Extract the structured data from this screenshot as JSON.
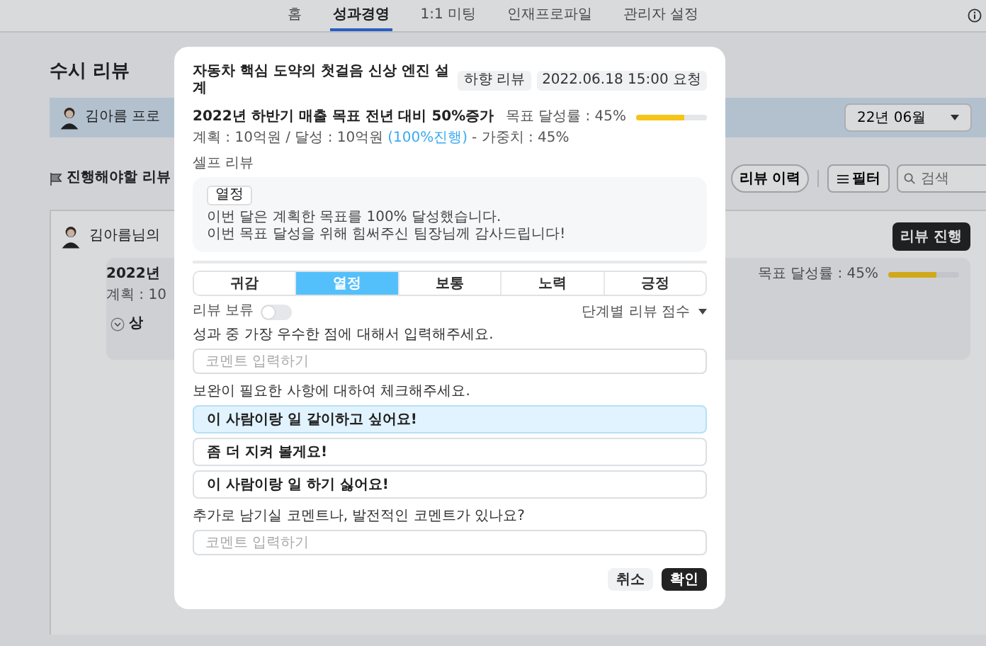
{
  "nav": {
    "items": [
      {
        "label": "홈",
        "selected": false
      },
      {
        "label": "성과경영",
        "selected": true
      },
      {
        "label": "1:1 미팅",
        "selected": false
      },
      {
        "label": "인재프로파일",
        "selected": false
      },
      {
        "label": "관리자 설정",
        "selected": false
      }
    ]
  },
  "page": {
    "title": "수시 리뷰",
    "profile_name": "김아름 프로",
    "month": "22년 06월",
    "section_title": "진행해야할 리뷰",
    "history_button": "리뷰 이력",
    "filter_button": "필터",
    "search_placeholder": "검색",
    "card": {
      "owner": "김아름님의",
      "action": "리뷰 진행",
      "goal": "2022년",
      "plan": "계획 : 10",
      "detail": "상",
      "progress_label": "목표 달성률 : 45%",
      "level": 0.68
    }
  },
  "dialog": {
    "title": "자동차 핵심 도약의 첫걸음 신상 엔진 설계",
    "tags": [
      "하향 리뷰",
      "2022.06.18 15:00 요청"
    ],
    "goal": {
      "title": "2022년 하반기 매출 목표 전년 대비 50%증가",
      "plan": "계획 : 10억원 / 달성 : 10억원",
      "progress": "(100%진행)",
      "weight": "-  가중치 : 45%",
      "progress_label": "목표 달성률 : 45%",
      "level": 0.68
    },
    "self_review": {
      "label": "셀프 리뷰",
      "tag": "열정",
      "lines": [
        "이번 달은 계획한 목표를 100% 달성했습니다.",
        "이번 목표 달성을 위해 힘써주신 팀장님께 감사드립니다!"
      ]
    },
    "scores": [
      {
        "label": "귀감",
        "selected": false
      },
      {
        "label": "열정",
        "selected": true
      },
      {
        "label": "보통",
        "selected": false
      },
      {
        "label": "노력",
        "selected": false
      },
      {
        "label": "긍정",
        "selected": false
      }
    ],
    "hold": {
      "label": "리뷰 보류",
      "on": false
    },
    "score_menu": "단계별 리뷰 점수",
    "best_prompt": "성과 중 가장 우수한 점에 대해서 입력해주세요.",
    "best_placeholder": "코멘트 입력하기",
    "improve_prompt": "보완이 필요한 사항에 대하여 체크해주세요.",
    "options": [
      {
        "label": "이 사람이랑 일 같이하고 싶어요!",
        "selected": true
      },
      {
        "label": "좀 더 지켜 볼게요!",
        "selected": false
      },
      {
        "label": "이 사람이랑 일 하기 싫어요!",
        "selected": false
      }
    ],
    "extra_prompt": "추가로 남기실 코멘트나, 발전적인 코멘트가 있나요?",
    "extra_placeholder": "코멘트 입력하기",
    "buttons": [
      {
        "label": "취소",
        "kind": "secondary"
      },
      {
        "label": "확인",
        "kind": "primary"
      }
    ]
  }
}
